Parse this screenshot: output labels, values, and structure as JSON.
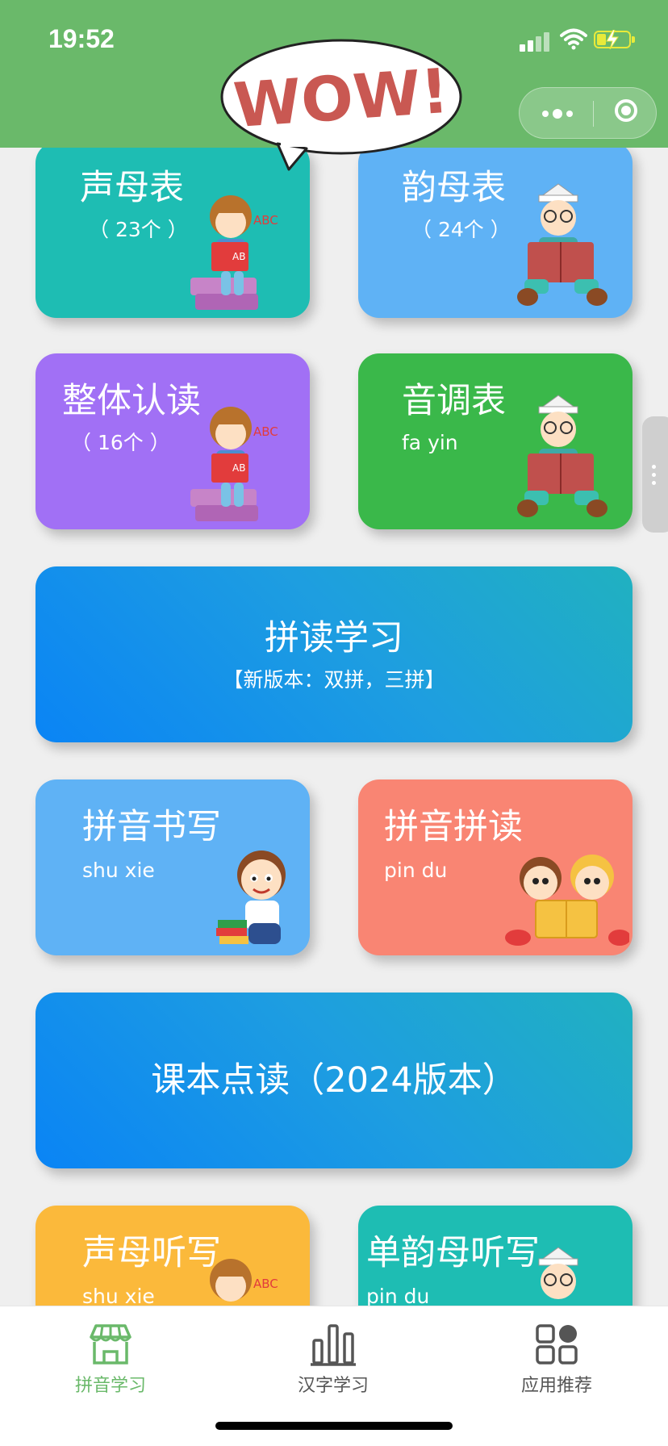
{
  "status_bar": {
    "time": "19:52",
    "battery_level": 0.3
  },
  "header": {
    "logo_text": "WOW!"
  },
  "cards": [
    {
      "title": "声母表",
      "subtitle": "（ 23个 ）",
      "color": "#1ebdb3"
    },
    {
      "title": "韵母表",
      "subtitle": "（ 24个 ）",
      "color": "#5fb2f5"
    },
    {
      "title": "整体认读",
      "subtitle": "（ 16个 ）",
      "color": "#a170f5"
    },
    {
      "title": "音调表",
      "subtitle": "fa yin",
      "color": "#3ab84a"
    },
    {
      "title": "拼读学习",
      "subtitle": "【新版本：双拼，三拼】"
    },
    {
      "title": "拼音书写",
      "subtitle": "shu xie",
      "color": "#5fb2f5"
    },
    {
      "title": "拼音拼读",
      "subtitle": "pin du",
      "color": "#f98573"
    },
    {
      "title": "课本点读（2024版本）"
    },
    {
      "title": "声母听写",
      "subtitle": "shu xie",
      "color": "#fbb93b"
    },
    {
      "title": "单韵母听写",
      "subtitle": "pin du",
      "color": "#1ebdb3"
    }
  ],
  "tabbar": {
    "active_color": "#6ab96a",
    "tabs": [
      {
        "label": "拼音学习",
        "icon": "store-icon",
        "active": true
      },
      {
        "label": "汉字学习",
        "icon": "bar-chart-icon",
        "active": false
      },
      {
        "label": "应用推荐",
        "icon": "apps-grid-icon",
        "active": false
      }
    ]
  }
}
